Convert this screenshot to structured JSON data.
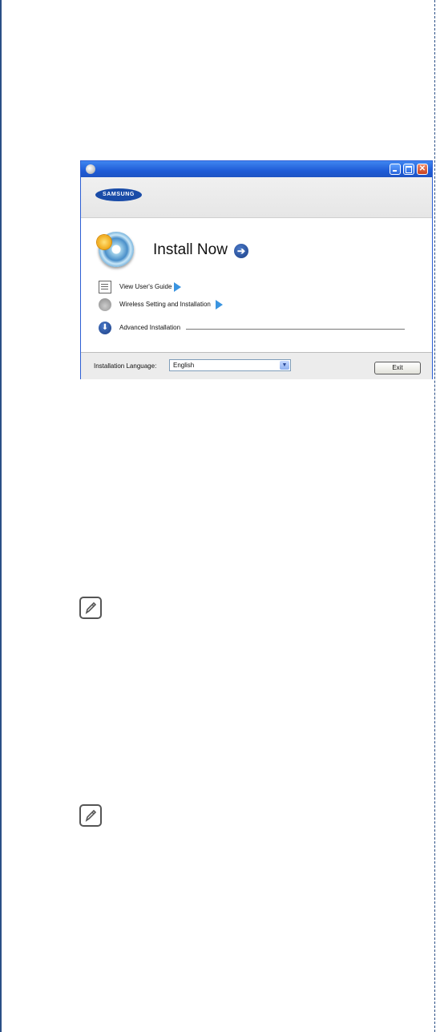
{
  "installer": {
    "brand": "SAMSUNG",
    "install_label": "Install Now",
    "links": [
      {
        "label": "View User's Guide"
      },
      {
        "label": "Wireless Setting and Installation"
      }
    ],
    "advanced_label": "Advanced Installation",
    "language_label": "Installation Language:",
    "language_value": "English",
    "exit_label": "Exit"
  },
  "icons": {
    "app": "disc-icon",
    "install": "install-disc-icon",
    "guide": "user-guide-icon",
    "wireless": "wireless-icon",
    "advanced": "download-arrow-icon",
    "note": "note-pencil-icon"
  },
  "colors": {
    "titlebar": "#1f5cd7",
    "page_rule": "#2a4f86",
    "link_arrow": "#3a94e0"
  }
}
